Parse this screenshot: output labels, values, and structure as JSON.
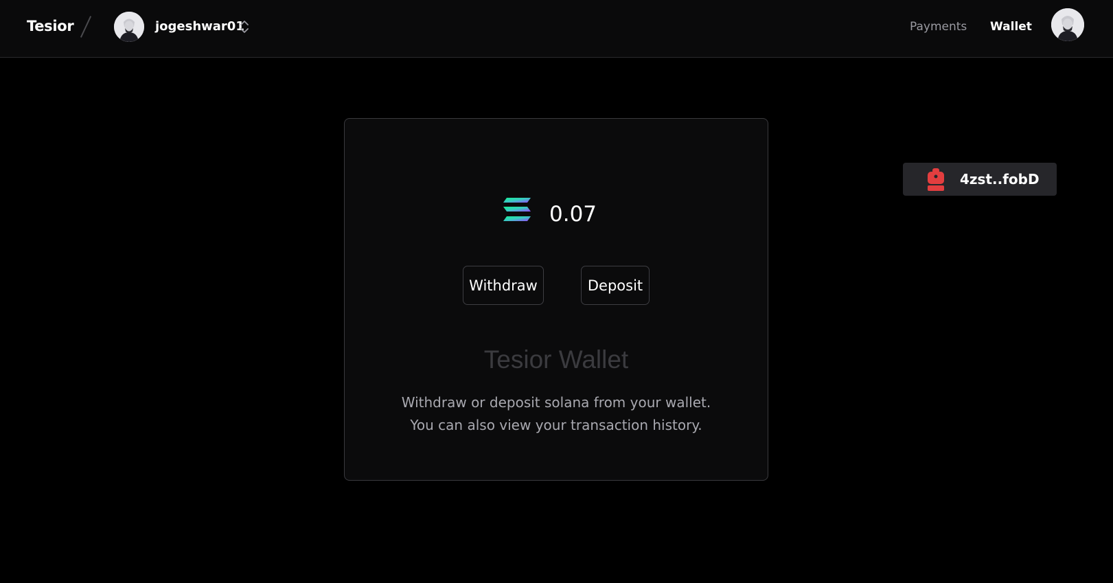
{
  "header": {
    "brand": "Tesior",
    "username": "jogeshwar01",
    "nav": {
      "payments": "Payments",
      "wallet": "Wallet"
    },
    "icons": {
      "team_avatar": "user-avatar-icon",
      "switcher": "chevron-up-down-icon",
      "profile_avatar": "user-avatar-icon"
    }
  },
  "wallet_card": {
    "token_icon": "solana-icon",
    "balance": "0.07",
    "withdraw_label": "Withdraw",
    "deposit_label": "Deposit",
    "title": "Tesior Wallet",
    "description_line1": "Withdraw or deposit solana from your wallet.",
    "description_line2": "You can also view your transaction history."
  },
  "wallet_connect": {
    "icon": "backpack-icon",
    "address": "4zst..fobD"
  },
  "colors": {
    "background": "#000000",
    "navbar": "#0a0a0b",
    "card": "#0b0b0c",
    "border": "#3a3a3e",
    "muted_text": "#9a9aa1",
    "title_text": "#3b3b3f",
    "badge_bg": "#26262a",
    "backpack_red": "#e33e3f",
    "solana_green": "#14f195",
    "solana_purple": "#9945ff"
  }
}
